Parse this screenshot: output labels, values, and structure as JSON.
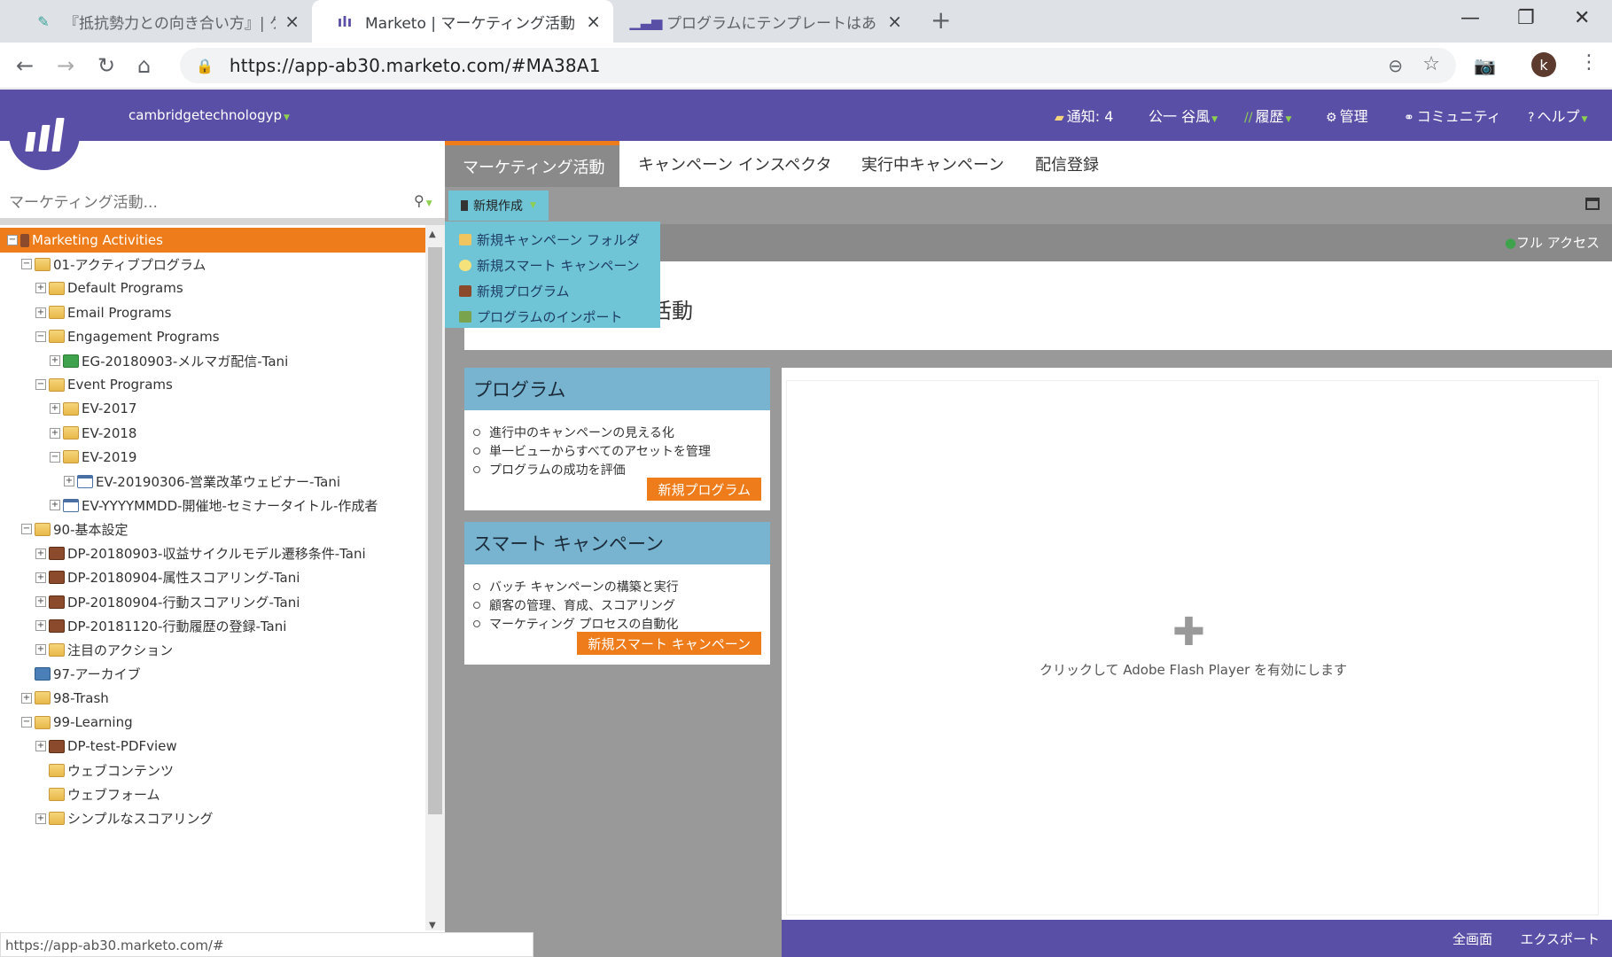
{
  "browser": {
    "tabs": [
      {
        "title": "『抵抗勢力との向き合い方』| ケンブ",
        "favicon": "bird-icon"
      },
      {
        "title": "Marketo | マーケティング活動",
        "favicon": "marketo-icon"
      },
      {
        "title": "プログラムにテンプレートはありますでし",
        "favicon": "bars-icon"
      }
    ],
    "url": "https://app-ab30.marketo.com/#MA38A1",
    "avatar_letter": "k",
    "status_url": "https://app-ab30.marketo.com/#"
  },
  "header": {
    "workspace": "cambridgetechnologyp",
    "notifications": "通知: 4",
    "user": "公一 谷風",
    "history": "履歴",
    "admin": "管理",
    "community": "コミュニティ",
    "help": "ヘルプ",
    "accent": "#5a4fa6"
  },
  "sidebar": {
    "search_placeholder": "マーケティング活動...",
    "tree": [
      {
        "label": "Marketing Activities",
        "level": 0,
        "icon": "root",
        "exp": "−"
      },
      {
        "label": "01-アクティブプログラム",
        "level": 1,
        "icon": "folder",
        "exp": "−"
      },
      {
        "label": "Default Programs",
        "level": 2,
        "icon": "folder",
        "exp": "+"
      },
      {
        "label": "Email Programs",
        "level": 2,
        "icon": "folder",
        "exp": "+"
      },
      {
        "label": "Engagement Programs",
        "level": 2,
        "icon": "folder",
        "exp": "−"
      },
      {
        "label": "EG-20180903-メルマガ配信-Tani",
        "level": 3,
        "icon": "engage",
        "exp": "+"
      },
      {
        "label": "Event Programs",
        "level": 2,
        "icon": "folder",
        "exp": "−"
      },
      {
        "label": "EV-2017",
        "level": 3,
        "icon": "folder",
        "exp": "+"
      },
      {
        "label": "EV-2018",
        "level": 3,
        "icon": "folder",
        "exp": "+"
      },
      {
        "label": "EV-2019",
        "level": 3,
        "icon": "folder",
        "exp": "−"
      },
      {
        "label": "EV-20190306-営業改革ウェビナー-Tani",
        "level": 4,
        "icon": "event",
        "exp": "+"
      },
      {
        "label": "EV-YYYYMMDD-開催地-セミナータイトル-作成者",
        "level": 3,
        "icon": "event",
        "exp": "+"
      },
      {
        "label": "90-基本設定",
        "level": 1,
        "icon": "folder",
        "exp": "−"
      },
      {
        "label": "DP-20180903-収益サイクルモデル遷移条件-Tani",
        "level": 2,
        "icon": "prog",
        "exp": "+"
      },
      {
        "label": "DP-20180904-属性スコアリング-Tani",
        "level": 2,
        "icon": "prog",
        "exp": "+"
      },
      {
        "label": "DP-20180904-行動スコアリング-Tani",
        "level": 2,
        "icon": "prog",
        "exp": "+"
      },
      {
        "label": "DP-20181120-行動履歴の登録-Tani",
        "level": 2,
        "icon": "prog",
        "exp": "+"
      },
      {
        "label": "注目のアクション",
        "level": 2,
        "icon": "folder",
        "exp": "+"
      },
      {
        "label": "97-アーカイブ",
        "level": 1,
        "icon": "archive",
        "exp": ""
      },
      {
        "label": "98-Trash",
        "level": 1,
        "icon": "folder",
        "exp": "+"
      },
      {
        "label": "99-Learning",
        "level": 1,
        "icon": "folder",
        "exp": "−"
      },
      {
        "label": "DP-test-PDFview",
        "level": 2,
        "icon": "prog",
        "exp": "+"
      },
      {
        "label": "ウェブコンテンツ",
        "level": 2,
        "icon": "folder",
        "exp": ""
      },
      {
        "label": "ウェブフォーム",
        "level": 2,
        "icon": "folder",
        "exp": ""
      },
      {
        "label": "シンプルなスコアリング",
        "level": 2,
        "icon": "folder",
        "exp": "+"
      }
    ]
  },
  "main": {
    "tabs": [
      "マーケティング活動",
      "キャンペーン インスペクタ",
      "実行中キャンペーン",
      "配信登録"
    ],
    "new_button": "新規作成",
    "full_access": "フル アクセス",
    "dropdown": [
      {
        "label": "新規キャンペーン フォルダ",
        "icon": "folder"
      },
      {
        "label": "新規スマート キャンペーン",
        "icon": "bulb"
      },
      {
        "label": "新規プログラム",
        "icon": "prog"
      },
      {
        "label": "プログラムのインポート",
        "icon": "import"
      }
    ],
    "page_title": "活動",
    "program_card": {
      "title": "プログラム",
      "items": [
        "進行中のキャンペーンの見える化",
        "単一ビューからすべてのアセットを管理",
        "プログラムの成功を評価"
      ],
      "button": "新規プログラム"
    },
    "smart_card": {
      "title": "スマート キャンペーン",
      "items": [
        "バッチ キャンペーンの構築と実行",
        "顧客の管理、育成、スコアリング",
        "マーケティング プロセスの自動化"
      ],
      "button": "新規スマート キャンペーン"
    },
    "flash_message": "クリックして Adobe Flash Player を有効にします",
    "footer": {
      "fullscreen": "全画面",
      "export": "エクスポート"
    }
  }
}
